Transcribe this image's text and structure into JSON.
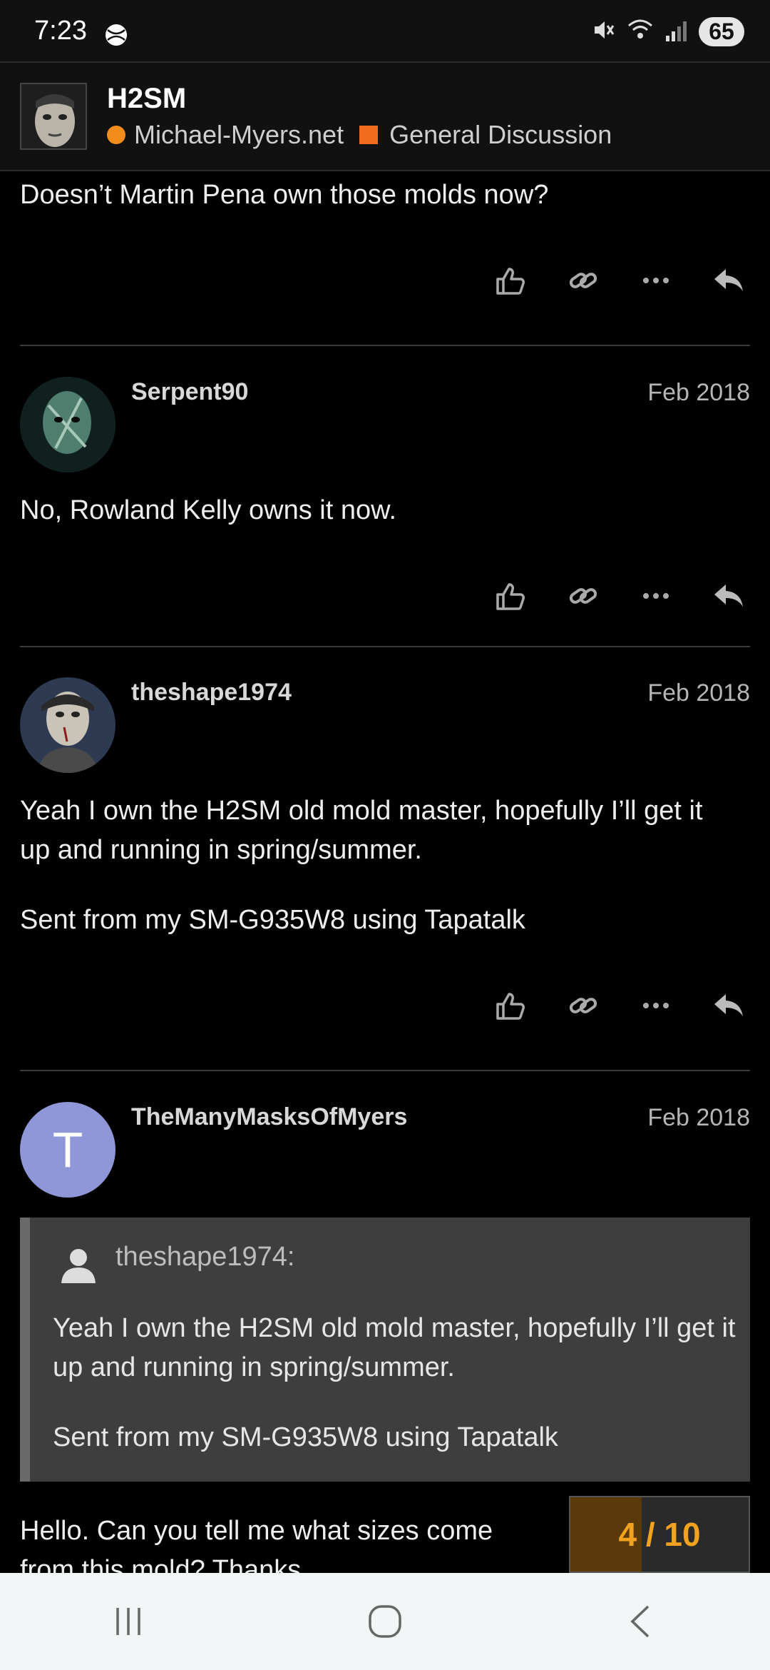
{
  "status": {
    "time": "7:23",
    "battery": "65"
  },
  "header": {
    "title": "H2SM",
    "site": "Michael-Myers.net",
    "category": "General Discussion"
  },
  "posts": [
    {
      "text": "Doesn’t Martin Pena own those molds now?"
    },
    {
      "username": "Serpent90",
      "date": "Feb 2018",
      "text": "No, Rowland Kelly owns it now."
    },
    {
      "username": "theshape1974",
      "date": "Feb 2018",
      "text1": "Yeah I own the H2SM old mold master, hopefully I’ll get it up and running in spring/summer.",
      "text2": "Sent from my SM-G935W8 using Tapatalk"
    },
    {
      "username": "TheManyMasksOfMyers",
      "date": "Feb 2018",
      "avatar_letter": "T",
      "quote": {
        "user": "theshape1974:",
        "text1": "Yeah I own the H2SM old mold master, hopefully I’ll get it up and running in spring/summer.",
        "text2": "Sent from my SM-G935W8 using Tapatalk"
      },
      "text": "Hello. Can you tell me what sizes come from this mold? Thanks"
    }
  ],
  "progress": {
    "label": "4 / 10",
    "fraction": 0.4
  },
  "colors": {
    "accent": "#f2a21e",
    "avatar_t": "#8f97d8",
    "category": "#f26a1b"
  }
}
